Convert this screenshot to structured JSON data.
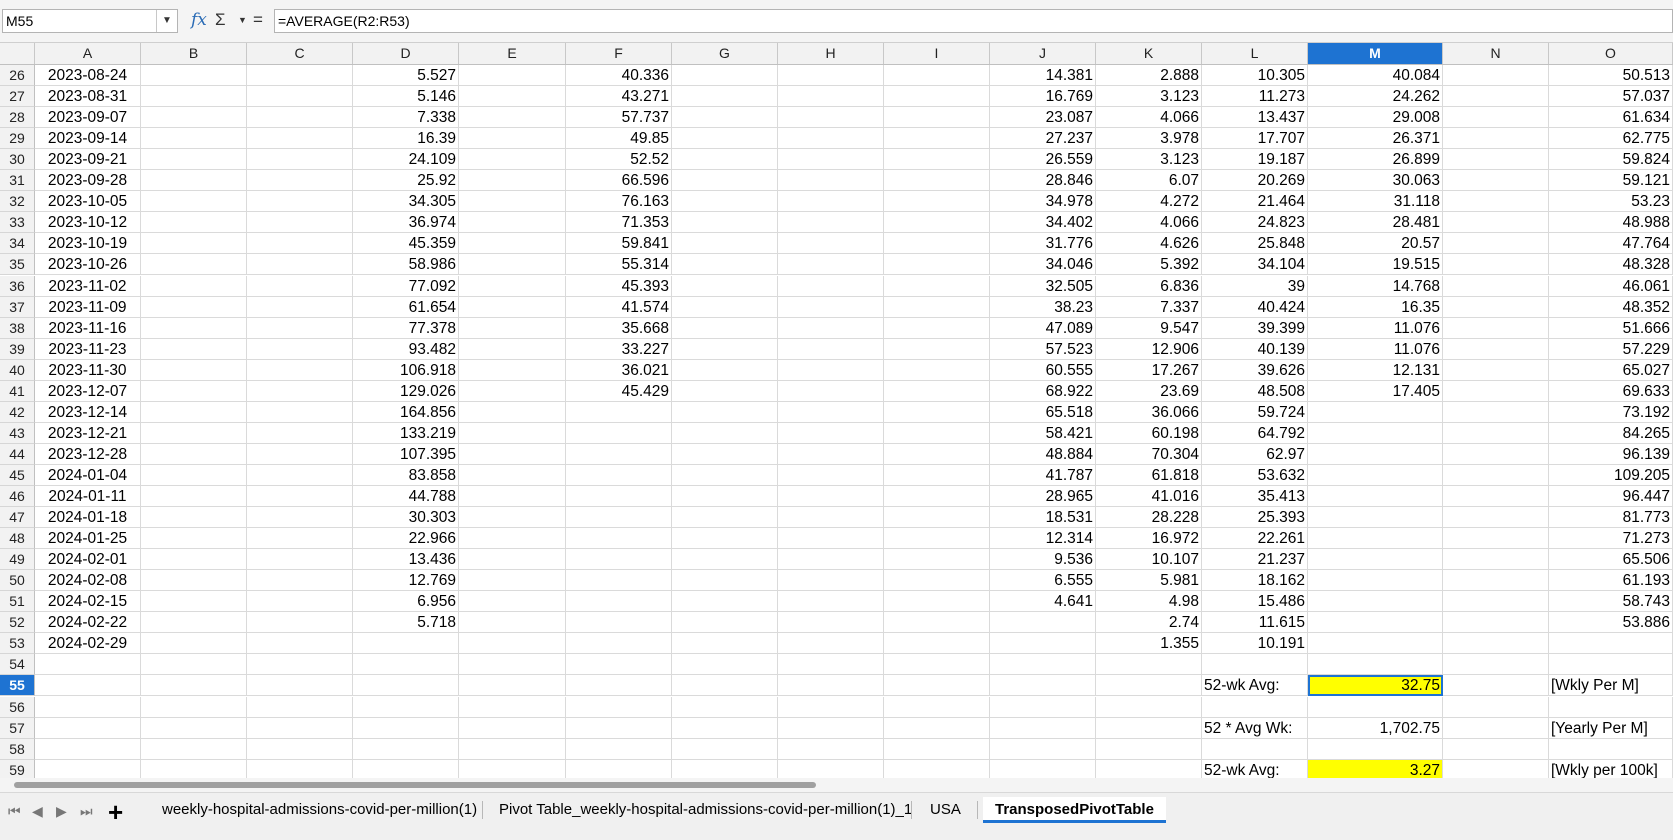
{
  "formula_bar": {
    "name_box": "M55",
    "fx_icon": "fx",
    "sum_icon": "Σ",
    "eq_icon": "=",
    "formula": "=AVERAGE(R2:R53)"
  },
  "columns": [
    "A",
    "B",
    "C",
    "D",
    "E",
    "F",
    "G",
    "H",
    "I",
    "J",
    "K",
    "L",
    "M",
    "N",
    "O"
  ],
  "selected_column": "M",
  "selected_row": 55,
  "rows": [
    {
      "n": 26,
      "A": "2023-08-24",
      "D": "5.527",
      "F": "40.336",
      "J": "14.381",
      "K": "2.888",
      "L": "10.305",
      "M": "40.084",
      "O": "50.513"
    },
    {
      "n": 27,
      "A": "2023-08-31",
      "D": "5.146",
      "F": "43.271",
      "J": "16.769",
      "K": "3.123",
      "L": "11.273",
      "M": "24.262",
      "O": "57.037"
    },
    {
      "n": 28,
      "A": "2023-09-07",
      "D": "7.338",
      "F": "57.737",
      "J": "23.087",
      "K": "4.066",
      "L": "13.437",
      "M": "29.008",
      "O": "61.634"
    },
    {
      "n": 29,
      "A": "2023-09-14",
      "D": "16.39",
      "F": "49.85",
      "J": "27.237",
      "K": "3.978",
      "L": "17.707",
      "M": "26.371",
      "O": "62.775"
    },
    {
      "n": 30,
      "A": "2023-09-21",
      "D": "24.109",
      "F": "52.52",
      "J": "26.559",
      "K": "3.123",
      "L": "19.187",
      "M": "26.899",
      "O": "59.824"
    },
    {
      "n": 31,
      "A": "2023-09-28",
      "D": "25.92",
      "F": "66.596",
      "J": "28.846",
      "K": "6.07",
      "L": "20.269",
      "M": "30.063",
      "O": "59.121"
    },
    {
      "n": 32,
      "A": "2023-10-05",
      "D": "34.305",
      "F": "76.163",
      "J": "34.978",
      "K": "4.272",
      "L": "21.464",
      "M": "31.118",
      "O": "53.23"
    },
    {
      "n": 33,
      "A": "2023-10-12",
      "D": "36.974",
      "F": "71.353",
      "J": "34.402",
      "K": "4.066",
      "L": "24.823",
      "M": "28.481",
      "O": "48.988"
    },
    {
      "n": 34,
      "A": "2023-10-19",
      "D": "45.359",
      "F": "59.841",
      "J": "31.776",
      "K": "4.626",
      "L": "25.848",
      "M": "20.57",
      "O": "47.764"
    },
    {
      "n": 35,
      "A": "2023-10-26",
      "D": "58.986",
      "F": "55.314",
      "J": "34.046",
      "K": "5.392",
      "L": "34.104",
      "M": "19.515",
      "O": "48.328"
    },
    {
      "n": 36,
      "A": "2023-11-02",
      "D": "77.092",
      "F": "45.393",
      "J": "32.505",
      "K": "6.836",
      "L": "39",
      "M": "14.768",
      "O": "46.061"
    },
    {
      "n": 37,
      "A": "2023-11-09",
      "D": "61.654",
      "F": "41.574",
      "J": "38.23",
      "K": "7.337",
      "L": "40.424",
      "M": "16.35",
      "O": "48.352"
    },
    {
      "n": 38,
      "A": "2023-11-16",
      "D": "77.378",
      "F": "35.668",
      "J": "47.089",
      "K": "9.547",
      "L": "39.399",
      "M": "11.076",
      "O": "51.666"
    },
    {
      "n": 39,
      "A": "2023-11-23",
      "D": "93.482",
      "F": "33.227",
      "J": "57.523",
      "K": "12.906",
      "L": "40.139",
      "M": "11.076",
      "O": "57.229"
    },
    {
      "n": 40,
      "A": "2023-11-30",
      "D": "106.918",
      "F": "36.021",
      "J": "60.555",
      "K": "17.267",
      "L": "39.626",
      "M": "12.131",
      "O": "65.027"
    },
    {
      "n": 41,
      "A": "2023-12-07",
      "D": "129.026",
      "F": "45.429",
      "J": "68.922",
      "K": "23.69",
      "L": "48.508",
      "M": "17.405",
      "O": "69.633"
    },
    {
      "n": 42,
      "A": "2023-12-14",
      "D": "164.856",
      "J": "65.518",
      "K": "36.066",
      "L": "59.724",
      "O": "73.192"
    },
    {
      "n": 43,
      "A": "2023-12-21",
      "D": "133.219",
      "J": "58.421",
      "K": "60.198",
      "L": "64.792",
      "O": "84.265"
    },
    {
      "n": 44,
      "A": "2023-12-28",
      "D": "107.395",
      "J": "48.884",
      "K": "70.304",
      "L": "62.97",
      "O": "96.139"
    },
    {
      "n": 45,
      "A": "2024-01-04",
      "D": "83.858",
      "J": "41.787",
      "K": "61.818",
      "L": "53.632",
      "O": "109.205"
    },
    {
      "n": 46,
      "A": "2024-01-11",
      "D": "44.788",
      "J": "28.965",
      "K": "41.016",
      "L": "35.413",
      "O": "96.447"
    },
    {
      "n": 47,
      "A": "2024-01-18",
      "D": "30.303",
      "J": "18.531",
      "K": "28.228",
      "L": "25.393",
      "O": "81.773"
    },
    {
      "n": 48,
      "A": "2024-01-25",
      "D": "22.966",
      "J": "12.314",
      "K": "16.972",
      "L": "22.261",
      "O": "71.273"
    },
    {
      "n": 49,
      "A": "2024-02-01",
      "D": "13.436",
      "J": "9.536",
      "K": "10.107",
      "L": "21.237",
      "O": "65.506"
    },
    {
      "n": 50,
      "A": "2024-02-08",
      "D": "12.769",
      "J": "6.555",
      "K": "5.981",
      "L": "18.162",
      "O": "61.193"
    },
    {
      "n": 51,
      "A": "2024-02-15",
      "D": "6.956",
      "J": "4.641",
      "K": "4.98",
      "L": "15.486",
      "O": "58.743"
    },
    {
      "n": 52,
      "A": "2024-02-22",
      "D": "5.718",
      "K": "2.74",
      "L": "11.615",
      "O": "53.886"
    },
    {
      "n": 53,
      "A": "2024-02-29",
      "K": "1.355",
      "L": "10.191"
    },
    {
      "n": 54
    },
    {
      "n": 55,
      "L": "52-wk Avg:",
      "M": "32.75",
      "O": "[Wkly Per M]"
    },
    {
      "n": 56
    },
    {
      "n": 57,
      "L": "52 * Avg Wk:",
      "M": "1,702.75",
      "O": "[Yearly Per M]"
    },
    {
      "n": 58
    },
    {
      "n": 59,
      "L": "52-wk Avg:",
      "M": "3.27",
      "O": "[Wkly per 100k]"
    }
  ],
  "highlight_cells": [
    "M55",
    "M59"
  ],
  "highlight_color": "#ffff00",
  "selection_color": "#1e73d2",
  "tabs": [
    {
      "label": "weekly-hospital-admissions-covid-per-million(1)",
      "active": false
    },
    {
      "label": "Pivot Table_weekly-hospital-admissions-covid-per-million(1)_1",
      "active": false
    },
    {
      "label": "USA",
      "active": false
    },
    {
      "label": "TransposedPivotTable",
      "active": true
    }
  ],
  "tab_nav": {
    "first_icon": "⏮",
    "prev_icon": "◀",
    "next_icon": "▶",
    "last_icon": "⏭",
    "add_icon": "+"
  }
}
